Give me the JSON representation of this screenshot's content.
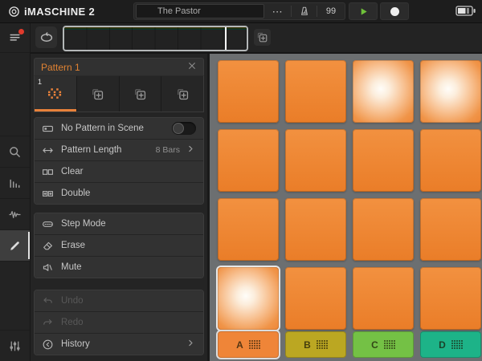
{
  "topbar": {
    "logo_text": "iMASCHINE 2",
    "project_title": "The Pastor",
    "tempo": "99"
  },
  "scene_strip": {
    "bars": 8,
    "playhead_pct": 88,
    "tracks": [
      {
        "name": "A",
        "bright": "#f08a38",
        "dim": "#7c4d16",
        "filled_pct": 100
      },
      {
        "name": "B",
        "bright": "#e6d23a",
        "dim": "#665a15",
        "filled_pct": 50
      },
      {
        "name": "C",
        "bright": "#8bd64f",
        "dim": "#35561f",
        "filled_pct": 13.5
      },
      {
        "name": "D",
        "bright": "#27c795",
        "dim": "#175a4c",
        "filled_pct": 12.5
      }
    ]
  },
  "pattern_panel": {
    "title": "Pattern 1",
    "tabs": [
      {
        "type": "pattern",
        "number": "1",
        "selected": true
      },
      {
        "type": "add"
      },
      {
        "type": "add"
      },
      {
        "type": "add"
      }
    ],
    "menu_groups": [
      {
        "items": [
          {
            "label": "No Pattern in Scene",
            "icon": "pattern-slot",
            "toggle": "off"
          },
          {
            "label": "Pattern Length",
            "icon": "arrows-horizontal",
            "value": "8 Bars",
            "chevron": true
          },
          {
            "label": "Clear",
            "icon": "clear"
          },
          {
            "label": "Double",
            "icon": "double"
          }
        ]
      },
      {
        "items": [
          {
            "label": "Step Mode",
            "icon": "step-mode"
          },
          {
            "label": "Erase",
            "icon": "erase"
          },
          {
            "label": "Mute",
            "icon": "mute"
          }
        ]
      },
      {
        "items": [
          {
            "label": "Undo",
            "icon": "undo",
            "disabled": true
          },
          {
            "label": "Redo",
            "icon": "redo",
            "disabled": true
          },
          {
            "label": "History",
            "icon": "history",
            "chevron": true
          }
        ]
      }
    ]
  },
  "pads": {
    "count": 16,
    "lit_indices": [
      2,
      3,
      12
    ],
    "selected_index": 12
  },
  "groups": [
    {
      "label": "A",
      "color": "#ef8538",
      "selected": true
    },
    {
      "label": "B",
      "color": "#bba722",
      "selected": false
    },
    {
      "label": "C",
      "color": "#74c145",
      "selected": false
    },
    {
      "label": "D",
      "color": "#1db388",
      "selected": false
    }
  ],
  "colors": {
    "accent_orange": "#e8813a",
    "pad_area_bg": "#6c6f71",
    "play_green": "#6fc13a",
    "record_white": "#efefef"
  }
}
